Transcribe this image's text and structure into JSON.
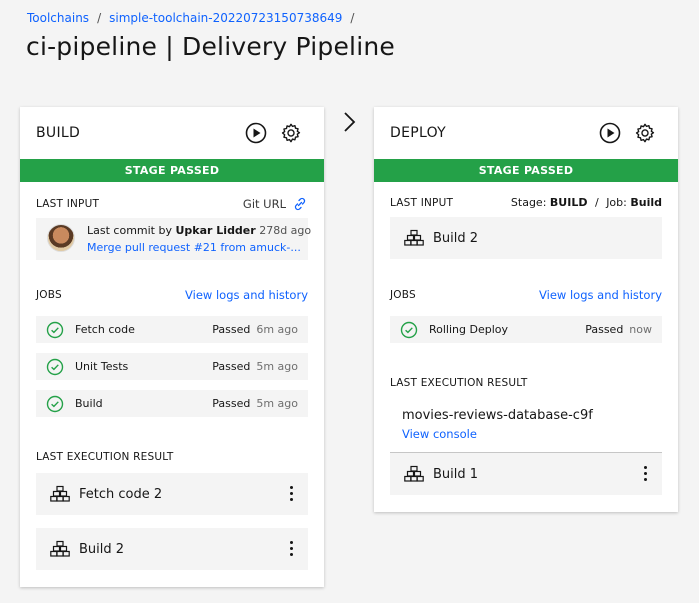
{
  "breadcrumb": {
    "items": [
      "Toolchains",
      "simple-toolchain-20220723150738649"
    ],
    "separator": "/"
  },
  "page_title": "ci-pipeline | Delivery Pipeline",
  "colors": {
    "accent": "#0f62fe",
    "success": "#24a148"
  },
  "build": {
    "name": "BUILD",
    "status": "STAGE PASSED",
    "last_input_label": "LAST INPUT",
    "git_url_label": "Git URL",
    "commit_prefix": "Last commit by",
    "commit_author": "Upkar Lidder",
    "commit_ago": "278d ago",
    "commit_message": "Merge pull request #21 from amuck-...",
    "jobs_label": "JOBS",
    "view_logs": "View logs and history",
    "jobs": [
      {
        "name": "Fetch code",
        "status": "Passed",
        "ago": "6m ago"
      },
      {
        "name": "Unit Tests",
        "status": "Passed",
        "ago": "5m ago"
      },
      {
        "name": "Build",
        "status": "Passed",
        "ago": "5m ago"
      }
    ],
    "last_exec_label": "LAST EXECUTION RESULT",
    "results": [
      "Fetch code 2",
      "Build 2"
    ]
  },
  "deploy": {
    "name": "DEPLOY",
    "status": "STAGE PASSED",
    "last_input_label": "LAST INPUT",
    "stage_label": "Stage:",
    "stage_value": "BUILD",
    "input_sep": "/",
    "job_label": "Job:",
    "job_value": "Build",
    "input_build": "Build 2",
    "jobs_label": "JOBS",
    "view_logs": "View logs and history",
    "jobs": [
      {
        "name": "Rolling Deploy",
        "status": "Passed",
        "ago": "now"
      }
    ],
    "last_exec_label": "LAST EXECUTION RESULT",
    "result_app": "movies-reviews-database-c9f",
    "view_console": "View console",
    "result_build": "Build 1"
  }
}
